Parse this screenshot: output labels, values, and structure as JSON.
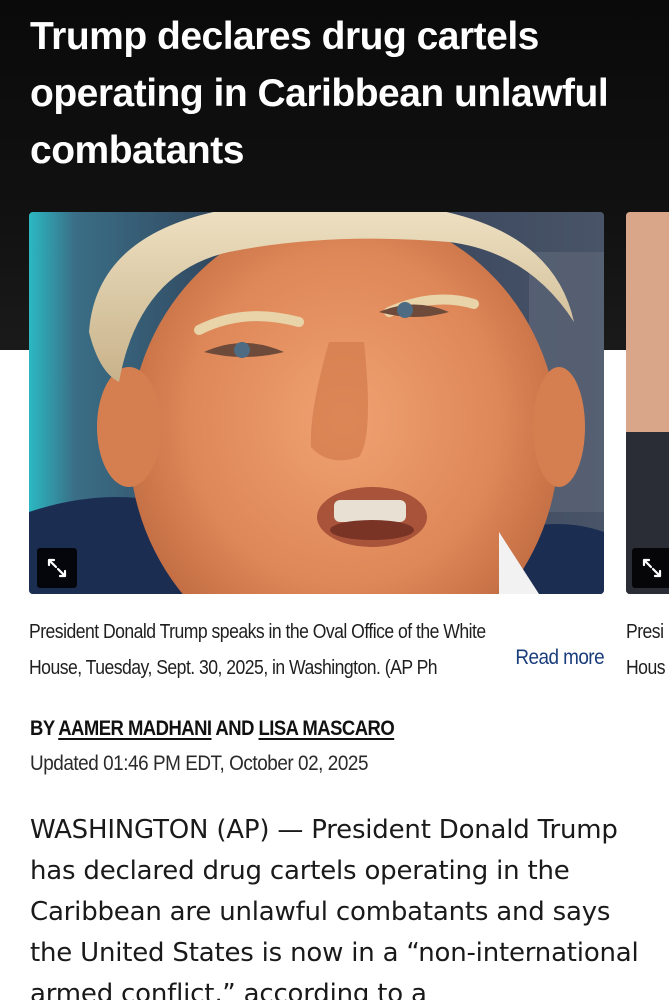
{
  "article": {
    "headline": "Trump declares drug cartels operating in Caribbean unlawful combatants",
    "byline_prefix": "BY",
    "author_1": "AAMER MADHANI",
    "byline_and": "AND",
    "author_2": "LISA MASCARO",
    "updated": "Updated 01:46 PM EDT, October 02, 2025",
    "body_paragraph": "WASHINGTON (AP) — President Donald Trump has declared drug cartels operating in the Caribbean are unlawful combatants and says the United States is now in a “non-international armed conflict,” according to a"
  },
  "gallery": {
    "caption_line_1": "President Donald Trump speaks in the Oval Office of the White",
    "caption_line_2": "House, Tuesday, Sept. 30, 2025, in Washington. (AP Ph",
    "read_more": "Read more",
    "next_caption_line_1": "Presi",
    "next_caption_line_2": "Hous",
    "expand_icon": "expand-arrows-icon"
  },
  "colors": {
    "header_background": "#111111",
    "headline_text": "#ffffff",
    "link_blue": "#1a3d7c",
    "body_text": "#1a1a1a"
  }
}
